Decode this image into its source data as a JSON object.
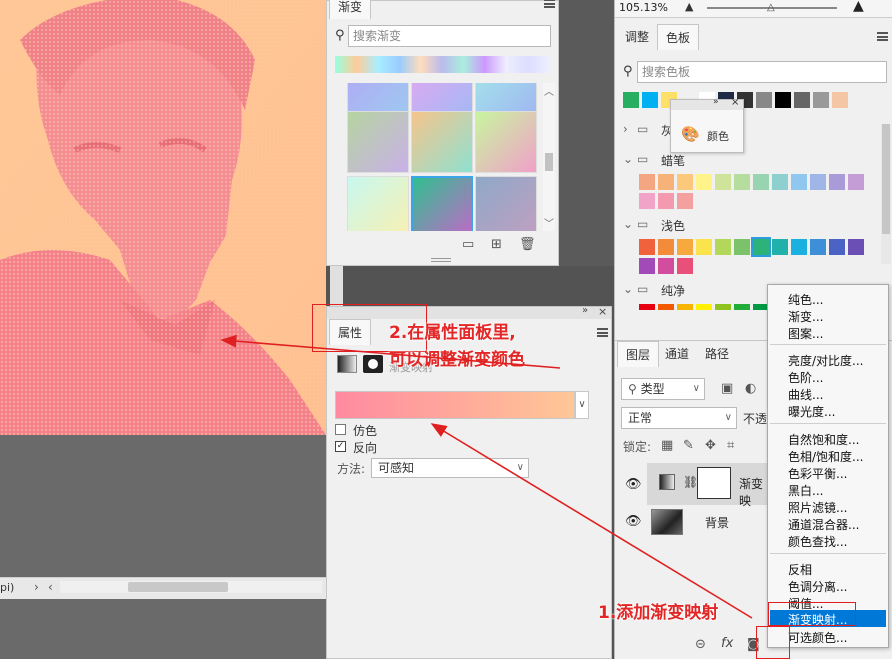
{
  "canvas": {
    "status_text": "pi)"
  },
  "gradient_panel": {
    "tab_label": "渐变",
    "search_placeholder": "搜索渐变"
  },
  "properties_panel": {
    "tab_label": "属性",
    "adj_label": "渐变映射",
    "dither_label": "仿色",
    "reverse_label": "反向",
    "method_label": "方法:",
    "method_value": "可感知",
    "gradient_colors": [
      "#ff8aa0",
      "#ffc796"
    ]
  },
  "top_right": {
    "zoom": "105.13%"
  },
  "swatches_panel": {
    "tabs": [
      "调整",
      "色板"
    ],
    "search_placeholder": "搜索色板",
    "groups": [
      "灰",
      "蜡笔",
      "浅色",
      "纯净"
    ],
    "top_colors": [
      "#27ae60",
      "#00b0f0",
      "#ffe066",
      "#f0f0f0",
      "#ffffff",
      "#1f2a44",
      "#333333",
      "#888888",
      "#000000",
      "#666666",
      "#999999",
      "#f5c6a5"
    ],
    "pastel_colors_row1": [
      "#f4a582",
      "#f7b27a",
      "#fbc87c",
      "#fff38a",
      "#cfe39a",
      "#b5dd9e",
      "#98d4b0",
      "#8ed0d0",
      "#8fc7ee",
      "#9fb6e6",
      "#a99bd8",
      "#c59dd6"
    ],
    "pastel_colors_row2": [
      "#f2a3c8",
      "#f49ab0",
      "#f5a0a0"
    ],
    "light_colors_row1": [
      "#f0623c",
      "#f28b3a",
      "#f7a93d",
      "#fbe44b",
      "#b3d75a",
      "#7cc26a",
      "#2db37a",
      "#20b2aa",
      "#1ab0e0",
      "#3d8fd8",
      "#4a63c4",
      "#6b4fb5"
    ],
    "light_colors_row2": [
      "#a24ab8",
      "#d24d9e",
      "#e8507a"
    ],
    "pure_colors_row": [
      "#e60012",
      "#f35a00",
      "#f8b500",
      "#fff100",
      "#8fc31f",
      "#22ac38",
      "#009944",
      "#009e96",
      "#00a0e9",
      "#0068b7",
      "#1d2088",
      "#920783"
    ]
  },
  "floating_color": {
    "label": "颜色"
  },
  "layers_panel": {
    "tabs": [
      "图层",
      "通道",
      "路径"
    ],
    "filter_label": "类型",
    "blend_mode": "正常",
    "opacity_label": "不透",
    "lock_label": "锁定:",
    "layers": [
      {
        "name": "渐变映",
        "type": "adjustment"
      },
      {
        "name": "背景",
        "type": "image"
      }
    ]
  },
  "context_menu": {
    "items_group1": [
      "纯色...",
      "渐变...",
      "图案..."
    ],
    "items_group2": [
      "亮度/对比度...",
      "色阶...",
      "曲线...",
      "曝光度..."
    ],
    "items_group3": [
      "自然饱和度...",
      "色相/饱和度...",
      "色彩平衡...",
      "黑白...",
      "照片滤镜...",
      "通道混合器...",
      "颜色查找..."
    ],
    "items_group4": [
      "反相",
      "色调分离...",
      "阈值...",
      "渐变映射...",
      "可选颜色..."
    ],
    "highlighted": "渐变映射..."
  },
  "annotations": {
    "step1": "1.添加渐变映射",
    "step2_line1": "2.在属性面板里,",
    "step2_line2": "可以调整渐变颜色"
  },
  "colors": {
    "accent": "#0078d7",
    "annotation_red": "#e02020"
  }
}
